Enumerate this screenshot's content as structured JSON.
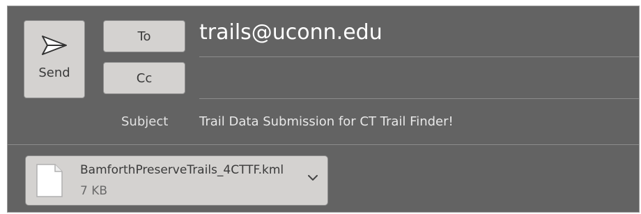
{
  "compose": {
    "send_label": "Send",
    "to_label": "To",
    "cc_label": "Cc",
    "to_value": "trails@uconn.edu",
    "cc_value": "",
    "subject_label": "Subject",
    "subject_value": "Trail Data Submission for CT Trail Finder!"
  },
  "attachment": {
    "name": "BamforthPreserveTrails_4CTTF.kml",
    "size": "7 KB"
  },
  "icons": {
    "send": "paper-plane-icon",
    "file": "document-icon",
    "menu": "chevron-down-icon"
  },
  "colors": {
    "background": "#636363",
    "button": "#d4d2d0",
    "text_light": "#ffffff"
  }
}
